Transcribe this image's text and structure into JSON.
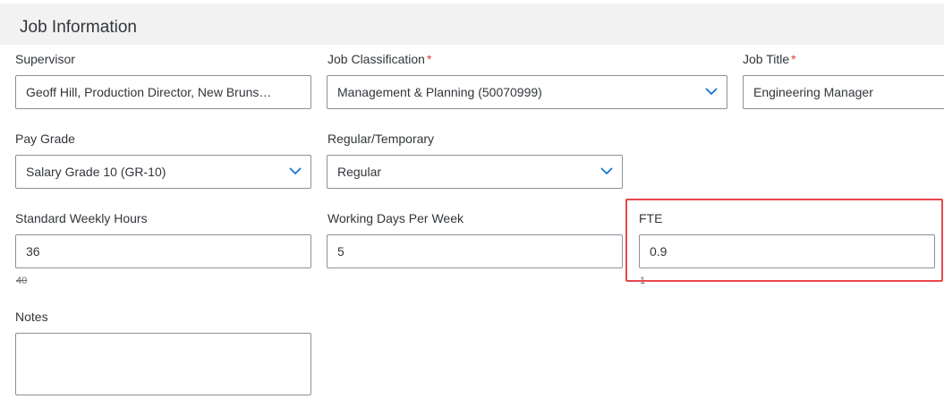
{
  "section": {
    "title": "Job Information"
  },
  "fields": {
    "supervisor": {
      "label": "Supervisor",
      "value": "Geoff Hill, Production Director, New Bruns…"
    },
    "job_classification": {
      "label": "Job Classification",
      "required": "*",
      "value": "Management & Planning (50070999)",
      "icon": "chevron-down-icon"
    },
    "job_title": {
      "label": "Job Title",
      "required": "*",
      "value": "Engineering Manager"
    },
    "pay_grade": {
      "label": "Pay Grade",
      "value": "Salary Grade 10 (GR-10)",
      "icon": "chevron-down-icon"
    },
    "regular_temporary": {
      "label": "Regular/Temporary",
      "value": "Regular",
      "icon": "chevron-down-icon"
    },
    "standard_weekly_hours": {
      "label": "Standard Weekly Hours",
      "value": "36",
      "previous": "40"
    },
    "working_days_per_week": {
      "label": "Working Days Per Week",
      "value": "5"
    },
    "fte": {
      "label": "FTE",
      "value": "0.9",
      "previous": "1"
    },
    "notes": {
      "label": "Notes",
      "value": ""
    }
  },
  "colors": {
    "required": "#e23a3a",
    "highlight_border": "#e8474d",
    "chevron": "#0a6ed1",
    "header_bg": "#f2f2f2"
  }
}
